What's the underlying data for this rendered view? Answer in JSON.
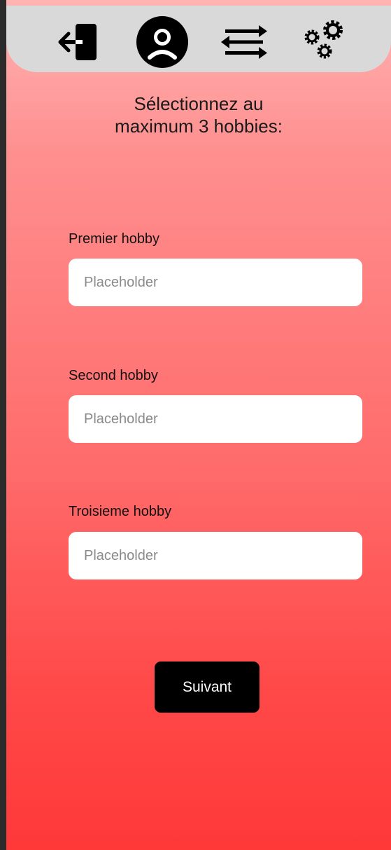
{
  "header": {
    "nav": [
      {
        "icon": "logout-icon"
      },
      {
        "icon": "profile-icon"
      },
      {
        "icon": "transfer-arrows-icon"
      },
      {
        "icon": "gears-icon"
      }
    ]
  },
  "main": {
    "title": "Sélectionnez au\nmaximum 3 hobbies:",
    "fields": [
      {
        "label": "Premier hobby",
        "placeholder": "Placeholder",
        "value": ""
      },
      {
        "label": "Second hobby",
        "placeholder": "Placeholder",
        "value": ""
      },
      {
        "label": "Troisieme hobby",
        "placeholder": "Placeholder",
        "value": ""
      }
    ],
    "next_label": "Suivant"
  },
  "colors": {
    "gradient_top": "#ffb3b3",
    "gradient_bottom": "#ff3838",
    "topbar": "#d9d9d9",
    "button": "#000000"
  }
}
